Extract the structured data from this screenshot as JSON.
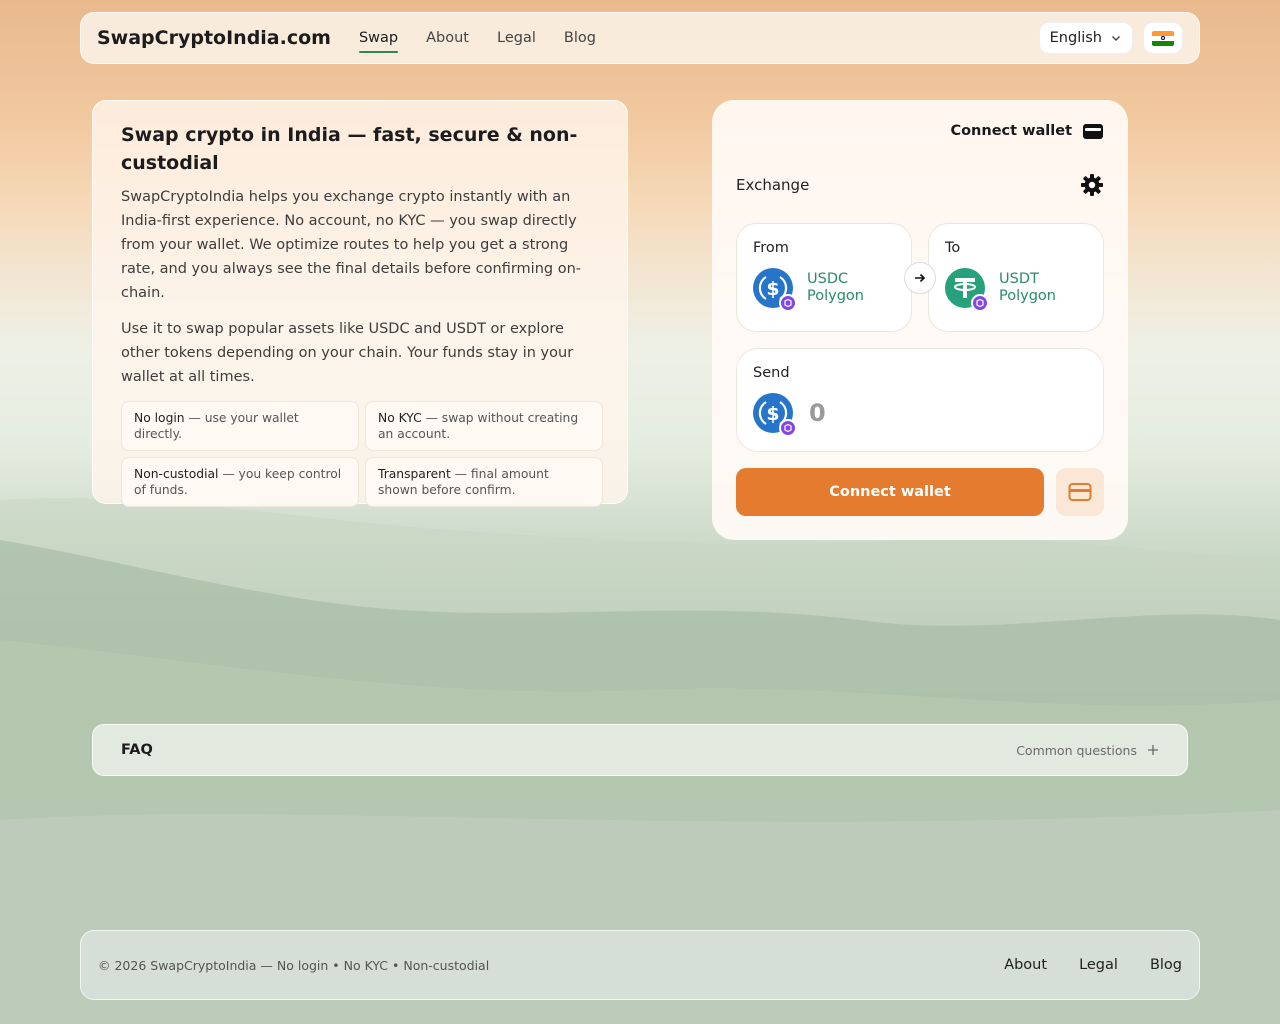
{
  "header": {
    "brand": "SwapCryptoIndia.com",
    "nav": [
      "Swap",
      "About",
      "Legal",
      "Blog"
    ],
    "language": "English",
    "flag_icon": "india-flag-icon"
  },
  "info": {
    "title": "Swap crypto in India — fast, secure & non-custodial",
    "para1": "SwapCryptoIndia helps you exchange crypto instantly with an India-first experience. No account, no KYC — you swap directly from your wallet. We optimize routes to help you get a strong rate, and you always see the final details before confirming on-chain.",
    "para2": "Use it to swap popular assets like USDC and USDT or explore other tokens depending on your chain. Your funds stay in your wallet at all times.",
    "features": [
      {
        "bold": "No login",
        "rest": " — use your wallet directly."
      },
      {
        "bold": "No KYC",
        "rest": " — swap without creating an account."
      },
      {
        "bold": "Non-custodial",
        "rest": " — you keep control of funds."
      },
      {
        "bold": "Transparent",
        "rest": " — final amount shown before confirm."
      }
    ]
  },
  "swap": {
    "connect_wallet_top": "Connect wallet",
    "exchange_label": "Exchange",
    "from_label": "From",
    "from_token": "USDC",
    "from_chain": "Polygon",
    "to_label": "To",
    "to_token": "USDT",
    "to_chain": "Polygon",
    "send_label": "Send",
    "send_placeholder": "0",
    "connect_button": "Connect wallet",
    "colors": {
      "accent": "#e47b2f",
      "usdc": "#2775ca",
      "usdt": "#26a17b",
      "polygon": "#8247e5",
      "token_text": "#2a8a6a"
    }
  },
  "faq": {
    "title": "FAQ",
    "subtitle": "Common questions"
  },
  "footer": {
    "copyright": "© 2026 SwapCryptoIndia — No login • No KYC • Non-custodial",
    "links": [
      "About",
      "Legal",
      "Blog"
    ]
  }
}
